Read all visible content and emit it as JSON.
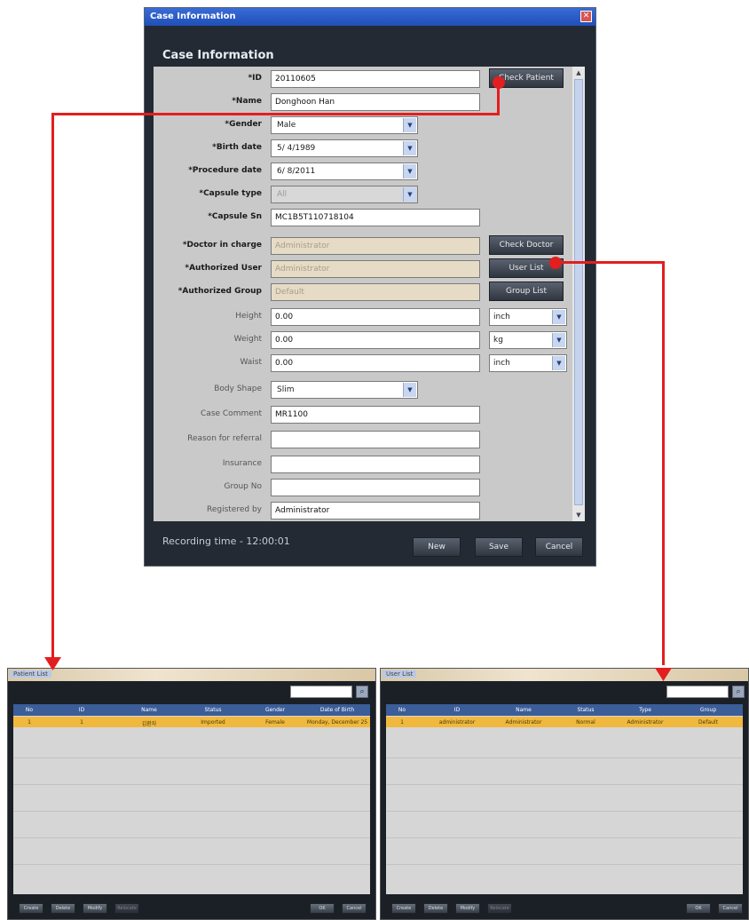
{
  "dialog": {
    "titlebar": "Case Information",
    "heading": "Case Information",
    "fields": [
      {
        "label": "*ID",
        "value": "20110605",
        "button": "Check Patient"
      },
      {
        "label": "*Name",
        "value": "Donghoon Han"
      },
      {
        "label": "*Gender",
        "value": "Male"
      },
      {
        "label": "*Birth date",
        "value": "5/ 4/1989"
      },
      {
        "label": "*Procedure date",
        "value": "6/ 8/2011"
      },
      {
        "label": "*Capsule type",
        "value": "All"
      },
      {
        "label": "*Capsule Sn",
        "value": "MC1B5T110718104"
      },
      {
        "label": "*Doctor in charge",
        "value": "Administrator",
        "button": "Check Doctor"
      },
      {
        "label": "*Authorized User",
        "value": "Administrator",
        "button": "User List"
      },
      {
        "label": "*Authorized Group",
        "value": "Default",
        "button": "Group List"
      },
      {
        "label": "Height",
        "value": "0.00",
        "unit": "inch"
      },
      {
        "label": "Weight",
        "value": "0.00",
        "unit": "kg"
      },
      {
        "label": "Waist",
        "value": "0.00",
        "unit": "inch"
      },
      {
        "label": "Body Shape",
        "value": "Slim"
      },
      {
        "label": "Case Comment",
        "value": "MR1100"
      },
      {
        "label": "Reason for referral",
        "value": ""
      },
      {
        "label": "Insurance",
        "value": ""
      },
      {
        "label": "Group No",
        "value": ""
      },
      {
        "label": "Registered by",
        "value": "Administrator"
      }
    ],
    "recording_time": "Recording time - 12:00:01",
    "buttons": {
      "new": "New",
      "save": "Save",
      "cancel": "Cancel"
    }
  },
  "patient_list": {
    "title": "Patient List",
    "columns": [
      "No",
      "ID",
      "Name",
      "Status",
      "Gender",
      "Date of Birth"
    ],
    "rows": [
      [
        "1",
        "1",
        "김환자",
        "Imported",
        "Female",
        "Monday, December 25"
      ]
    ],
    "buttons": [
      "Create",
      "Delete",
      "Modify",
      "Relocate",
      "OK",
      "Cancel"
    ]
  },
  "user_list": {
    "title": "User List",
    "columns": [
      "No",
      "ID",
      "Name",
      "Status",
      "Type",
      "Group"
    ],
    "rows": [
      [
        "1",
        "administrator",
        "Administrator",
        "Normal",
        "Administrator",
        "Default"
      ]
    ],
    "buttons": [
      "Create",
      "Delete",
      "Modify",
      "Relocate",
      "OK",
      "Cancel"
    ]
  },
  "colors": {
    "connector": "#e31e1e",
    "selected_row": "#f0b83e",
    "grid_header": "#3b5d98"
  }
}
